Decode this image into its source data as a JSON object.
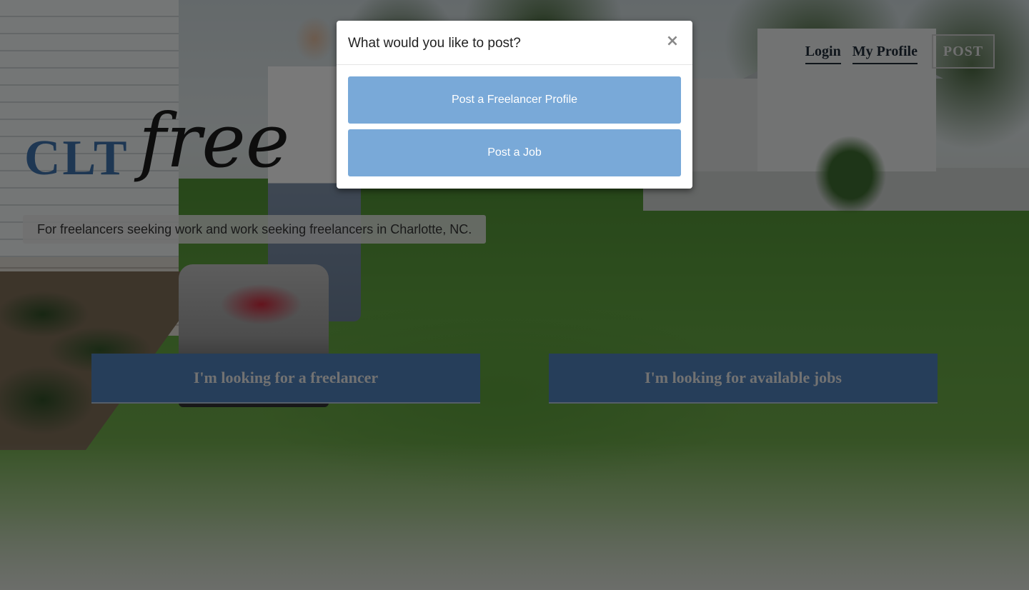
{
  "brand": {
    "logo_prefix": "CLT",
    "logo_suffix": "free",
    "tagline": "For freelancers seeking work and work seeking freelancers in Charlotte, NC."
  },
  "nav": {
    "login": "Login",
    "my_profile": "My Profile",
    "post": "POST"
  },
  "hero": {
    "cta_freelancer": "I'm looking for a freelancer",
    "cta_jobs": "I'm looking for available jobs"
  },
  "modal": {
    "title": "What would you like to post?",
    "close": "×",
    "options": [
      {
        "label": "Post a Freelancer Profile"
      },
      {
        "label": "Post a Job"
      }
    ]
  },
  "colors": {
    "brand_blue": "#3c6ea6",
    "cta_blue": "#4d7db5",
    "modal_button": "#79a9d8"
  }
}
